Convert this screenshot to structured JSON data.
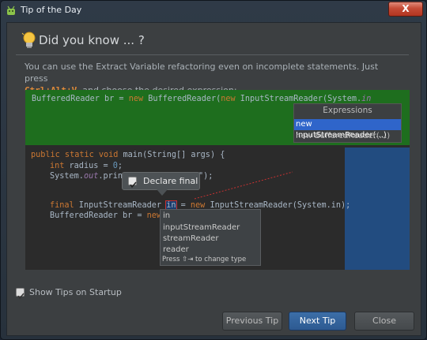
{
  "window": {
    "title": "Tip of the Day",
    "close_label": "X"
  },
  "tip": {
    "heading": "Did you know ... ?",
    "text_before": "You can use the Extract Variable refactoring even on incomplete statements. Just press",
    "shortcut": "Ctrl+Alt+V",
    "text_after": ", and choose the desired expression:"
  },
  "demo": {
    "top_line": {
      "type": "BufferedReader",
      "var": " br = ",
      "kw_new": "new",
      "ctor": " BufferedReader(",
      "kw_new2": "new",
      "ctor2": " InputStreamReader(System.",
      "ital": "in"
    },
    "expressions_popup": {
      "title": "Expressions",
      "items": [
        "new InputStreamReader(...)",
        "new BufferedReader(...)"
      ]
    },
    "lines": {
      "main_sig_kw": "public static void",
      "main_sig_rest": " main(String[] args) {",
      "radius_kw": "int",
      "radius_rest": " radius = ",
      "radius_num": "0",
      "radius_end": ";",
      "print_start": "System.",
      "print_out": "out",
      "print_rest": ".print",
      "print_tail": "\");",
      "final_kw": "final",
      "final_rest": " InputStreamReader ",
      "final_var": "in",
      "final_eq": " = ",
      "final_new": "new",
      "final_tail": " InputStreamReader(System.in);",
      "br_start": "BufferedReader br = ",
      "br_new": "new"
    },
    "declare_final_popup": {
      "label": "Declare final"
    },
    "completion_popup": {
      "items": [
        "in",
        "inputStreamReader",
        "streamReader",
        "reader"
      ],
      "footer": "Press ⇧⇥ to change type"
    }
  },
  "show_tips": {
    "label": "Show Tips on Startup",
    "checked": true
  },
  "buttons": {
    "previous": "Previous Tip",
    "next": "Next Tip",
    "close": "Close"
  }
}
